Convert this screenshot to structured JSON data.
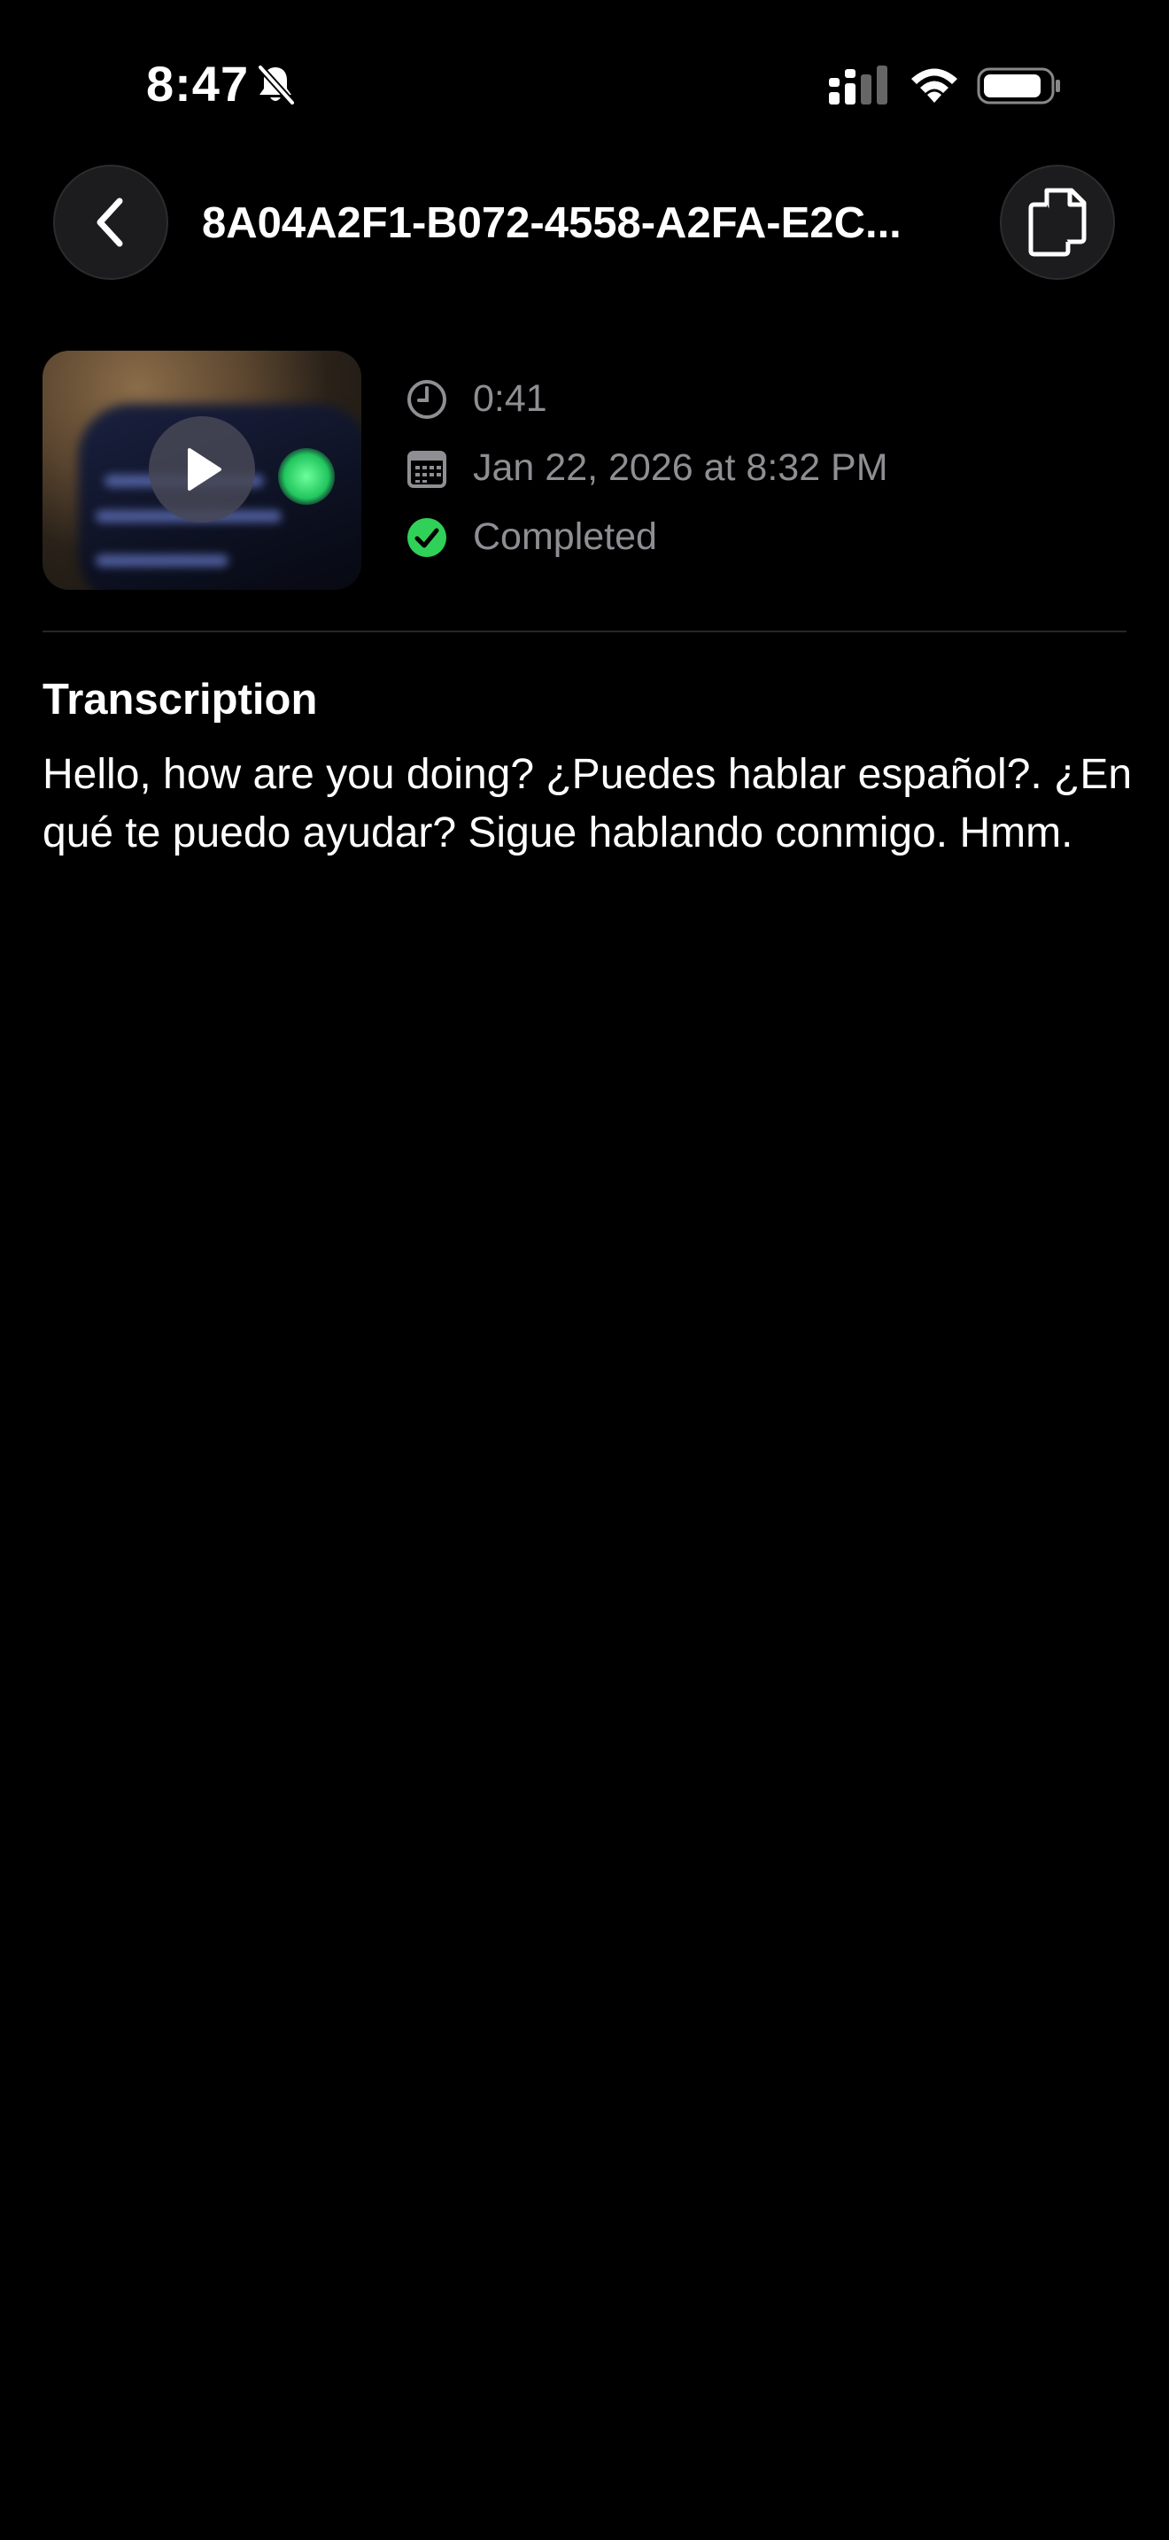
{
  "status_bar": {
    "time": "8:47",
    "icons": [
      "bell-slash-icon",
      "cellular-signal-icon",
      "wifi-icon",
      "battery-icon"
    ]
  },
  "nav": {
    "back_icon": "chevron-left-icon",
    "title": "8A04A2F1-B072-4558-A2FA-E2C...",
    "copy_icon": "document-on-document-icon"
  },
  "recording": {
    "thumbnail_icon": "play-icon",
    "duration": "0:41",
    "date": "Jan 22, 2026 at 8:32 PM",
    "status": "Completed",
    "status_color": "#30d158"
  },
  "transcription": {
    "heading": "Transcription",
    "text": "Hello, how are you doing? ¿Puedes hablar español?. ¿En qué te puedo ayudar? Sigue hablando conmigo. Hmm."
  },
  "colors": {
    "background": "#000000",
    "secondary_text": "#8e8e93",
    "button_fill": "#1c1c1e"
  }
}
